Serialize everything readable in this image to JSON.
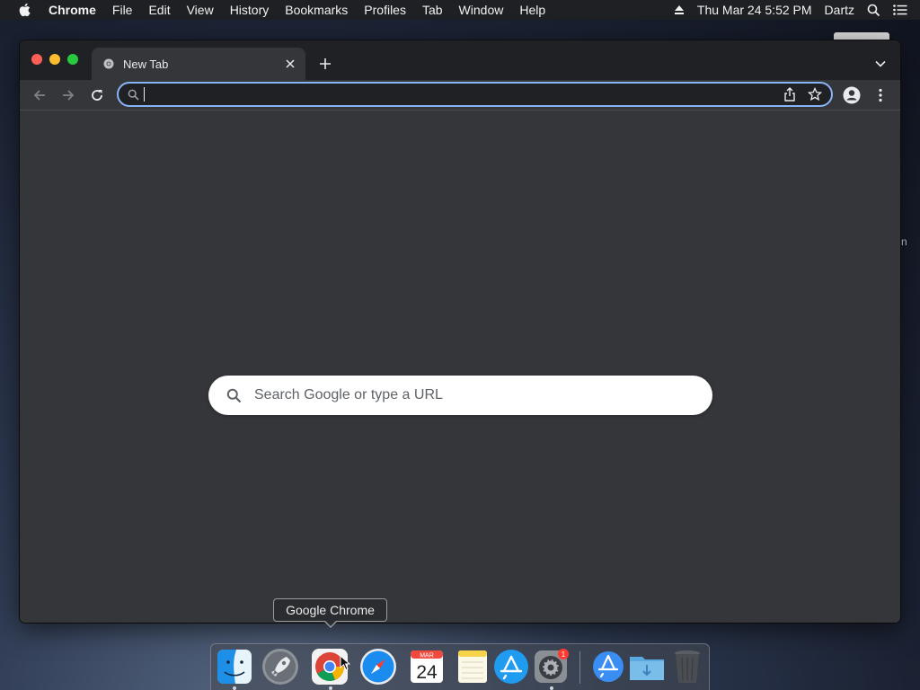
{
  "menubar": {
    "app_name": "Chrome",
    "items": [
      "File",
      "Edit",
      "View",
      "History",
      "Bookmarks",
      "Profiles",
      "Tab",
      "Window",
      "Help"
    ],
    "clock": "Thu Mar 24  5:52 PM",
    "user": "Dartz"
  },
  "background": {
    "partial_text": "n"
  },
  "browser": {
    "tab_title": "New Tab",
    "omnibox_value": "",
    "ntp_search_placeholder": "Search Google or type a URL"
  },
  "tooltip": {
    "text": "Google Chrome"
  },
  "dock": {
    "items": [
      "finder-icon",
      "launchpad-icon",
      "chrome-icon",
      "safari-icon",
      "calendar-icon",
      "notes-icon",
      "app-store-icon",
      "system-preferences-icon",
      "app-store-download-icon",
      "downloads-folder-icon",
      "trash-icon"
    ],
    "calendar_month": "MAR",
    "calendar_day": "24",
    "system_prefs_badge": "1"
  },
  "colors": {
    "accent": "#8ab4f8",
    "tab_bg": "#35363a",
    "strip_bg": "#202124"
  }
}
